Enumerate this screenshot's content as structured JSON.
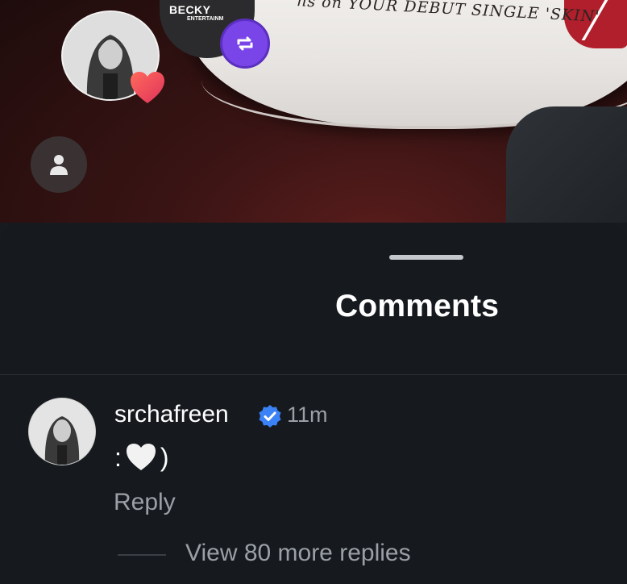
{
  "photo": {
    "cake_text": "ns on YOUR DEBUT SINGLE 'SKIN'",
    "brand_name": "BECKY",
    "brand_subtitle": "ENTERTAINM"
  },
  "sheet": {
    "title": "Comments"
  },
  "comment": {
    "username": "srchafreen",
    "time": "11m",
    "text_prefix": ":",
    "text_suffix": ")",
    "reply_label": "Reply",
    "view_more_label": "View 80 more replies"
  },
  "colors": {
    "background": "#161a1f",
    "text_secondary": "#9aa0a6",
    "verified": "#3b82f6",
    "repost_button": "#7a45e8"
  }
}
